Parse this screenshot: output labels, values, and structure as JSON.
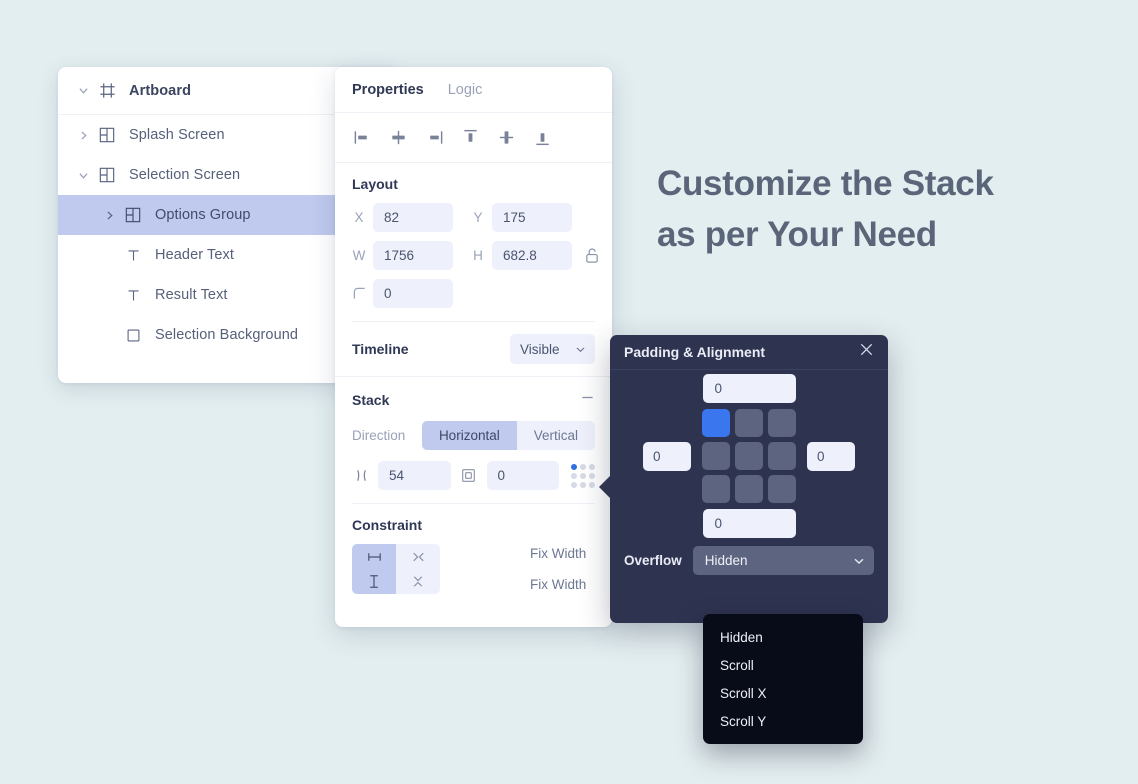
{
  "headline": {
    "line1": "Customize the Stack",
    "line2": "as per Your Need"
  },
  "layer_tree": {
    "items": [
      {
        "label": "Artboard",
        "icon": "artboard-icon",
        "caret": "down",
        "depth": 0,
        "selected": false
      },
      {
        "label": "Splash Screen",
        "icon": "frame-icon",
        "caret": "right",
        "depth": 0,
        "selected": false
      },
      {
        "label": "Selection Screen",
        "icon": "frame-icon",
        "caret": "down",
        "depth": 0,
        "selected": false
      },
      {
        "label": "Options Group",
        "icon": "frame-icon",
        "caret": "right",
        "depth": 1,
        "selected": true
      },
      {
        "label": "Header Text",
        "icon": "text-icon",
        "caret": "none",
        "depth": 1,
        "selected": false
      },
      {
        "label": "Result Text",
        "icon": "text-icon",
        "caret": "none",
        "depth": 1,
        "selected": false
      },
      {
        "label": "Selection Background",
        "icon": "rect-icon",
        "caret": "none",
        "depth": 1,
        "selected": false
      }
    ]
  },
  "properties": {
    "tabs": [
      {
        "label": "Properties",
        "active": true
      },
      {
        "label": "Logic",
        "active": false
      }
    ],
    "align_buttons": [
      "align-left-icon",
      "align-center-horizontal-icon",
      "align-right-icon",
      "align-top-icon",
      "align-center-vertical-icon",
      "align-bottom-icon"
    ],
    "layout": {
      "title": "Layout",
      "x_label": "X",
      "x_value": "82",
      "y_label": "Y",
      "y_value": "175",
      "w_label": "W",
      "w_value": "1756",
      "h_label": "H",
      "h_value": "682.8",
      "radius_label": "corner-radius-icon",
      "radius_value": "0",
      "lock_icon": "unlock-icon"
    },
    "timeline": {
      "title": "Timeline",
      "value": "Visible"
    },
    "stack": {
      "title": "Stack",
      "collapse_icon": "minus-icon",
      "direction_label": "Direction",
      "direction_options": [
        {
          "label": "Horizontal",
          "active": true
        },
        {
          "label": "Vertical",
          "active": false
        }
      ],
      "gap_icon": "gap-icon",
      "gap_value": "54",
      "padding_icon": "padding-icon",
      "padding_value": "0",
      "alignment_icon": "alignment-dot-grid-icon"
    },
    "constraint": {
      "title": "Constraint",
      "cells": [
        {
          "icon": "fix-width-icon",
          "active": true
        },
        {
          "icon": "hug-width-icon",
          "active": false
        },
        {
          "icon": "fix-height-icon",
          "active": true
        },
        {
          "icon": "hug-height-icon",
          "active": false
        }
      ],
      "labels": [
        "Fix Width",
        "Fix Width"
      ]
    }
  },
  "padding_panel": {
    "title": "Padding & Alignment",
    "close_icon": "close-icon",
    "padding_top": "0",
    "padding_left": "0",
    "padding_right": "0",
    "padding_bottom": "0",
    "alignment_selected_index": 0,
    "alignment_cells": 9,
    "overflow_label": "Overflow",
    "overflow_value": "Hidden"
  },
  "overflow_menu": {
    "items": [
      "Hidden",
      "Scroll",
      "Scroll X",
      "Scroll Y"
    ]
  },
  "colors": {
    "canvas_bg": "#e3eef0",
    "accent_blue": "#3a76ee",
    "selection_lavender": "#bfcaee",
    "panel_dark": "#2e3350",
    "menu_dark": "#080c18",
    "input_bg": "#eef1fb"
  }
}
